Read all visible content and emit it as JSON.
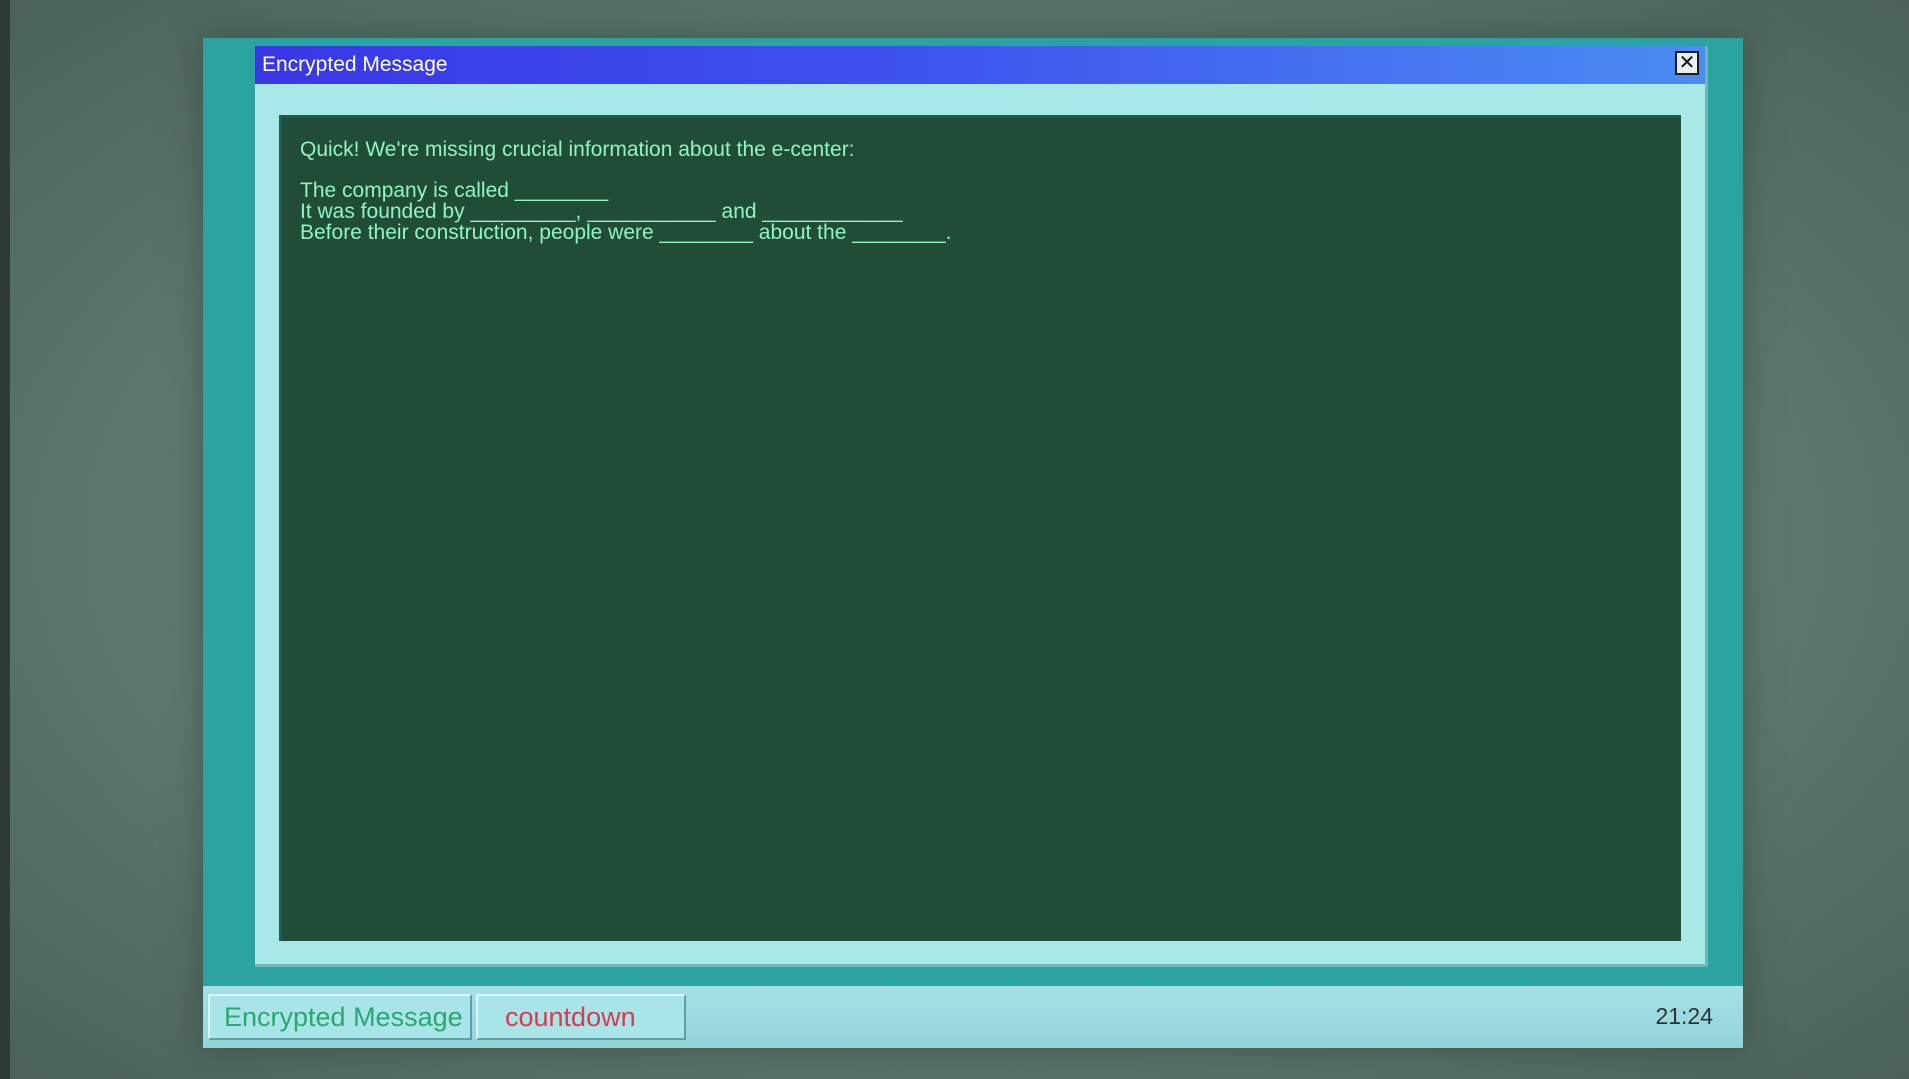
{
  "window": {
    "title": "Encrypted Message",
    "close_symbol": "✕",
    "message_lines": [
      "Quick! We're missing crucial information about the e-center:",
      "The company is called ________",
      "It was founded by _________, ___________ and ____________",
      "Before their construction, people were ________ about the ________."
    ]
  },
  "taskbar": {
    "items": [
      {
        "label": "Encrypted Message",
        "color": "#27a86f"
      },
      {
        "label": "countdown",
        "color": "#d63c4f"
      }
    ],
    "clock": "21:24"
  },
  "colors": {
    "titlebar_start": "#3a37e6",
    "titlebar_end": "#4b8cf3",
    "content_bg": "#214c38",
    "content_text": "#8ff5c2",
    "frame": "#2ba3a0"
  }
}
